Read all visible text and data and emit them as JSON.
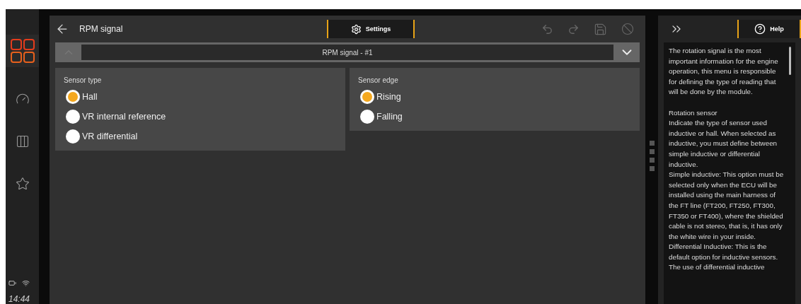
{
  "sidebar": {
    "items": [
      {
        "kind": "apps",
        "selected": true
      },
      {
        "kind": "gauge",
        "selected": false
      },
      {
        "kind": "columns",
        "selected": false
      },
      {
        "kind": "star",
        "selected": false
      }
    ],
    "time": "14:44"
  },
  "header": {
    "title": "RPM signal",
    "tab": "Settings"
  },
  "selector": {
    "value": "RPM signal - #1",
    "prev_disabled": true
  },
  "groups": [
    {
      "title": "Sensor type",
      "options": [
        {
          "label": "Hall",
          "selected": true
        },
        {
          "label": "VR internal reference",
          "selected": false
        },
        {
          "label": "VR differential",
          "selected": false
        }
      ]
    },
    {
      "title": "Sensor edge",
      "options": [
        {
          "label": "Rising",
          "selected": true
        },
        {
          "label": "Falling",
          "selected": false
        }
      ]
    }
  ],
  "help": {
    "tab": "Help",
    "sections": [
      [
        "The rotation signal is the most important information for the engine operation, this menu is responsible for defining the type of reading that will be done by the module."
      ],
      [
        "Rotation sensor",
        "Indicate the type of sensor used inductive or hall. When selected as inductive, you must define between simple inductive or differential inductive.",
        "Simple inductive: This option must be selected only when the ECU will be installed using the main harness of the FT line (FT200, FT250, FT300, FT350 or FT400), where the shielded cable is not stereo, that is, it has only the white wire in your inside.",
        "Differential Inductive: This is the default option for inductive sensors.",
        "The use of differential inductive"
      ]
    ]
  }
}
